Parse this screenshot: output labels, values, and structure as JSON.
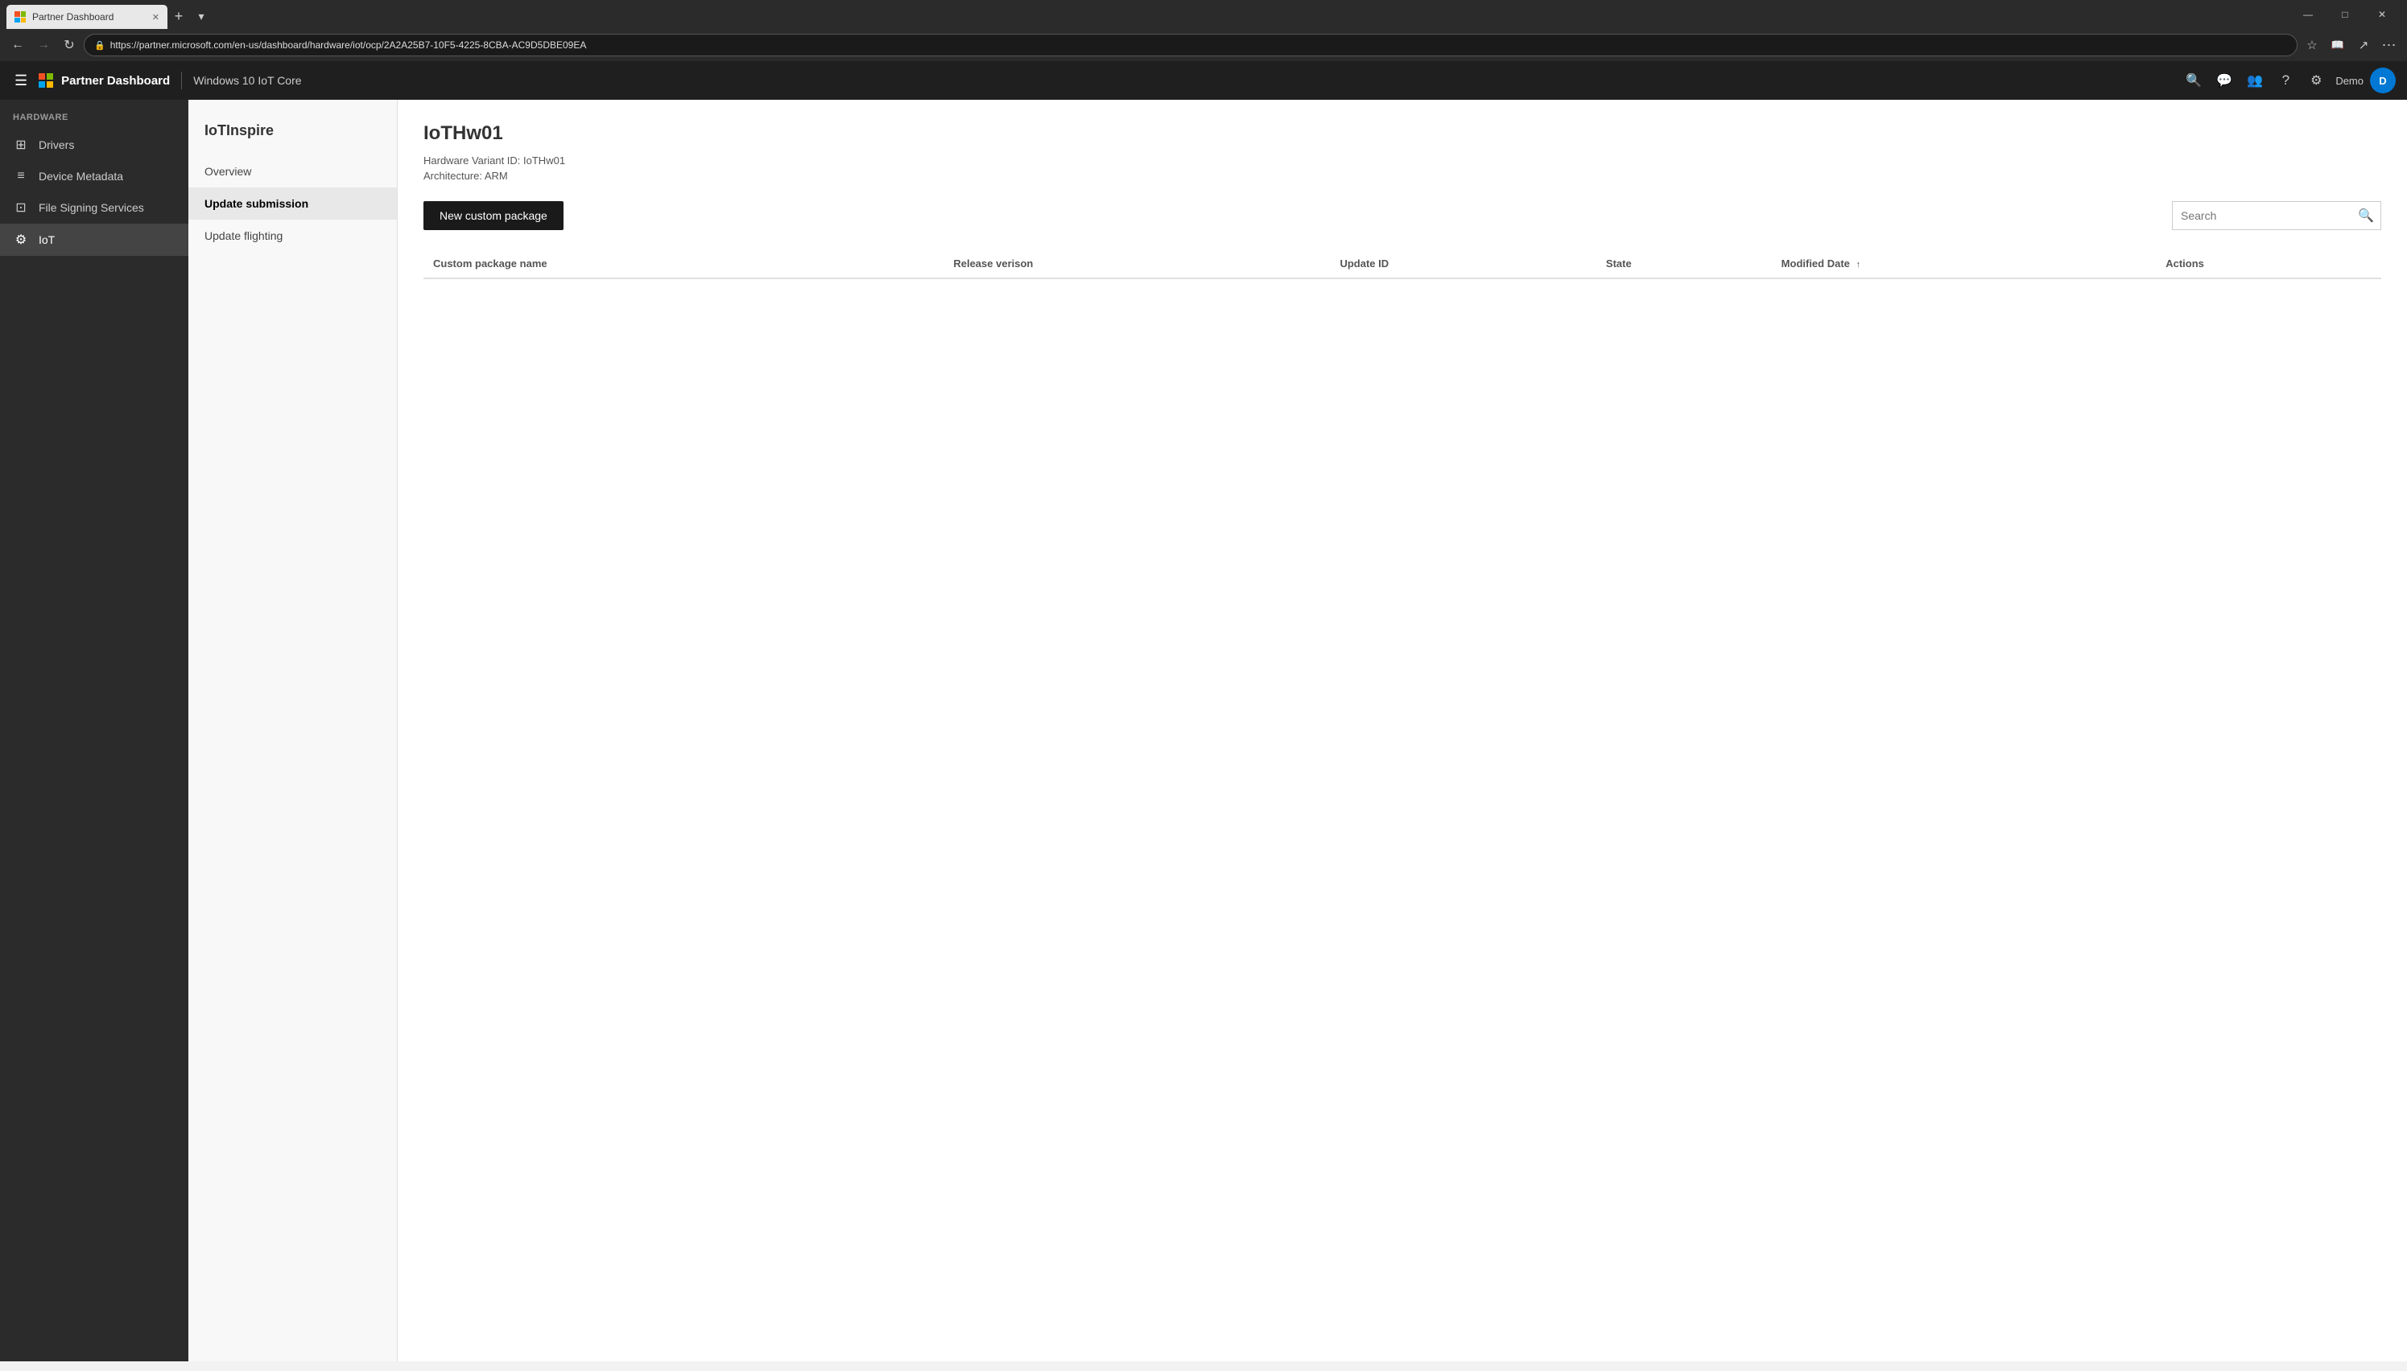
{
  "browser": {
    "tab_label": "Partner Dashboard",
    "url": "https://partner.microsoft.com/en-us/dashboard/hardware/iot/ocp/2A2A25B7-10F5-4225-8CBA-AC9D5DBE09EA",
    "new_tab_icon": "+",
    "dropdown_icon": "▾",
    "back_icon": "←",
    "forward_icon": "→",
    "refresh_icon": "↻",
    "more_icon": "⋯"
  },
  "topnav": {
    "app_title": "Partner Dashboard",
    "subtitle": "Windows 10 IoT Core",
    "search_icon": "🔍",
    "chat_icon": "💬",
    "users_icon": "👥",
    "help_icon": "?",
    "settings_icon": "⚙",
    "user_label": "Demo",
    "user_initials": "D"
  },
  "sidebar": {
    "section_label": "HARDWARE",
    "items": [
      {
        "id": "drivers",
        "label": "Drivers",
        "icon": "⊞"
      },
      {
        "id": "device-metadata",
        "label": "Device Metadata",
        "icon": "≡"
      },
      {
        "id": "file-signing",
        "label": "File Signing Services",
        "icon": "⊡"
      },
      {
        "id": "iot",
        "label": "IoT",
        "icon": "⚙"
      }
    ]
  },
  "subnav": {
    "title": "IoTInspire",
    "items": [
      {
        "id": "overview",
        "label": "Overview"
      },
      {
        "id": "update-submission",
        "label": "Update submission"
      },
      {
        "id": "update-flighting",
        "label": "Update flighting"
      }
    ]
  },
  "page": {
    "title": "IoTHw01",
    "variant_label": "Hardware Variant ID: IoTHw01",
    "architecture_label": "Architecture: ARM",
    "new_package_btn": "New custom package",
    "search_placeholder": "Search",
    "table": {
      "columns": [
        {
          "id": "name",
          "label": "Custom package name",
          "sortable": false
        },
        {
          "id": "release",
          "label": "Release verison",
          "sortable": false
        },
        {
          "id": "update-id",
          "label": "Update ID",
          "sortable": false
        },
        {
          "id": "state",
          "label": "State",
          "sortable": false
        },
        {
          "id": "modified",
          "label": "Modified Date",
          "sortable": true,
          "sort_dir": "asc"
        },
        {
          "id": "actions",
          "label": "Actions",
          "sortable": false
        }
      ],
      "rows": []
    }
  }
}
